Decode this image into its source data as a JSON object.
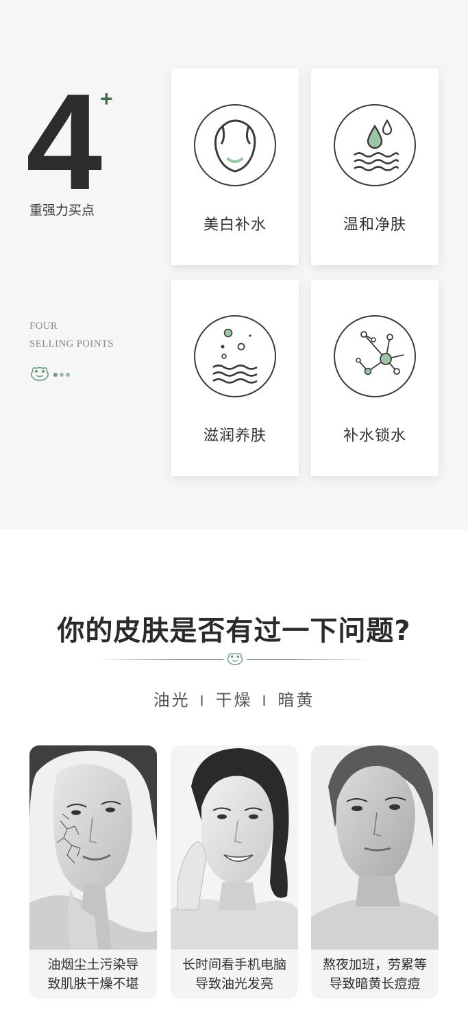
{
  "intro": {
    "big_number": "4",
    "plus": "+",
    "label": "重强力买点",
    "english_line1": "FOUR",
    "english_line2": "SELLING POINTS"
  },
  "features": [
    {
      "label": "美白补水",
      "icon": "face-icon"
    },
    {
      "label": "温和净肤",
      "icon": "water-drop-icon"
    },
    {
      "label": "滋润养肤",
      "icon": "bubbles-icon"
    },
    {
      "label": "补水锁水",
      "icon": "molecule-icon"
    }
  ],
  "question": {
    "title": "你的皮肤是否有过一下问题?",
    "keywords": [
      "油光",
      "干燥",
      "暗黄"
    ],
    "separator": "I"
  },
  "problems": [
    {
      "line1": "油烟尘土污染导",
      "line2": "致肌肤干燥不堪",
      "icon": "dry-skin-portrait"
    },
    {
      "line1": "长时间看手机电脑",
      "line2": "导致油光发亮",
      "icon": "oily-skin-portrait"
    },
    {
      "line1": "熬夜加班，劳累等",
      "line2": "导致暗黄长痘痘",
      "icon": "dull-skin-portrait"
    }
  ],
  "colors": {
    "accent_green": "#3f6b4f",
    "light_green": "#9cc5a8",
    "text_dark": "#333333",
    "section_bg": "#f6f6f6"
  }
}
